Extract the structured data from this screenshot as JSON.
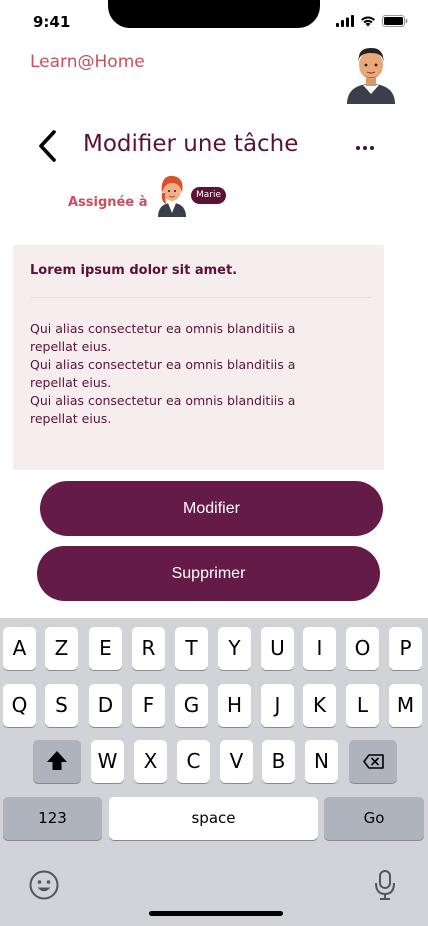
{
  "status_bar": {
    "time": "9:41"
  },
  "header": {
    "brand": "Learn@Home"
  },
  "page": {
    "title": "Modifier une tâche"
  },
  "assignee": {
    "label": "Assignée à",
    "name": "Marie"
  },
  "task": {
    "title": "Lorem ipsum dolor sit amet.",
    "body": "Qui alias consectetur ea omnis blanditiis a\n repellat eius.\nQui alias consectetur ea omnis blanditiis a\n repellat eius.\nQui alias consectetur ea omnis blanditiis a\n repellat eius."
  },
  "actions": {
    "modify": "Modifier",
    "delete": "Supprimer"
  },
  "keyboard": {
    "row1": [
      "A",
      "Z",
      "E",
      "R",
      "T",
      "Y",
      "U",
      "I",
      "O",
      "P"
    ],
    "row2": [
      "Q",
      "S",
      "D",
      "F",
      "G",
      "H",
      "J",
      "K",
      "L",
      "M"
    ],
    "row3": [
      "W",
      "X",
      "C",
      "V",
      "B",
      "N"
    ],
    "numbers": "123",
    "space": "space",
    "go": "Go"
  },
  "colors": {
    "accent": "#651b47",
    "brand": "#c8505e",
    "card": "#f6eeee"
  }
}
